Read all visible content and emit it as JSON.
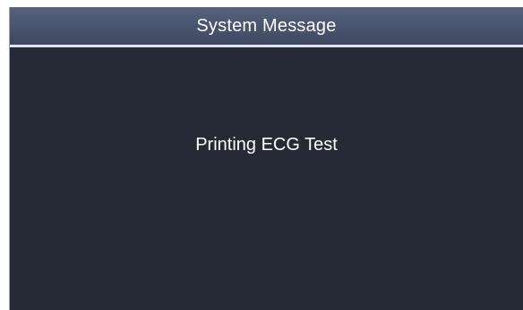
{
  "dialog": {
    "title": "System Message",
    "message": "Printing ECG Test"
  },
  "colors": {
    "title_bar": "#4b5670",
    "body_background": "#262a36",
    "text": "#ffffff",
    "title_separator": "#dfe4ee"
  }
}
